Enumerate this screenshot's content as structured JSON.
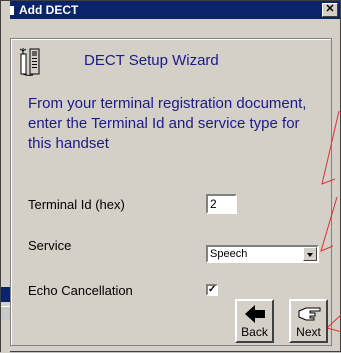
{
  "window": {
    "title": "Add DECT",
    "close_label": "✕"
  },
  "wizard": {
    "title": "DECT Setup Wizard",
    "instructions": "From your terminal registration document, enter the Terminal Id and service type for this handset"
  },
  "form": {
    "terminal_id_label": "Terminal Id (hex)",
    "terminal_id_value": "2",
    "service_label": "Service",
    "service_value": "Speech",
    "echo_label": "Echo Cancellation",
    "echo_checked": "✓"
  },
  "buttons": {
    "back_label": "Back",
    "next_label": "Next"
  },
  "colors": {
    "titlebar": "#0a246a",
    "instruction_text": "#1a1a8a",
    "annotation": "#e03030"
  }
}
